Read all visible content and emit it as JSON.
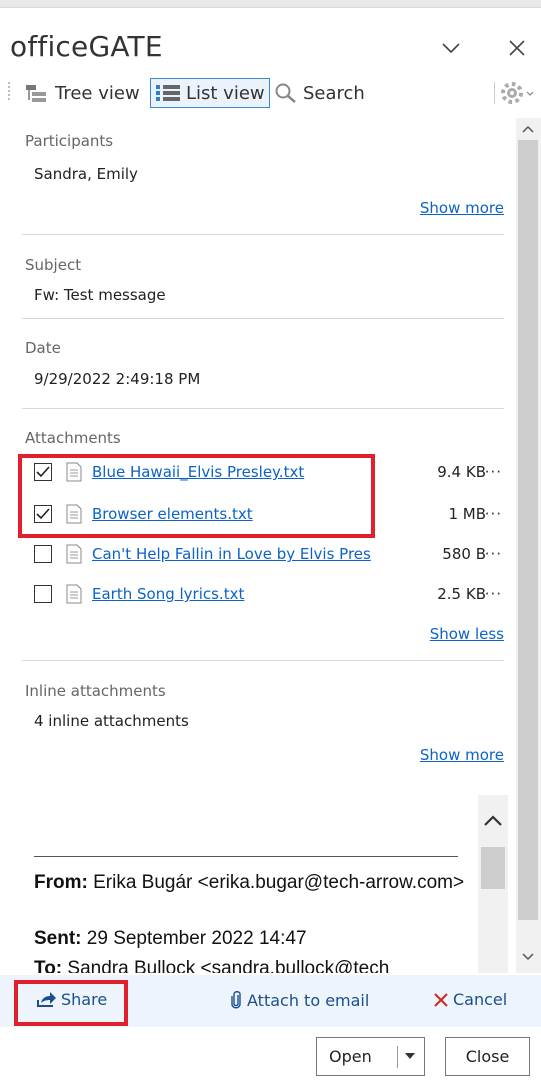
{
  "app": {
    "title": "officeGATE"
  },
  "toolbar": {
    "tree_view": "Tree view",
    "list_view": "List view",
    "search": "Search"
  },
  "participants": {
    "label": "Participants",
    "value": "Sandra, Emily",
    "show_more": "Show more"
  },
  "subject": {
    "label": "Subject",
    "value": "Fw: Test message"
  },
  "date": {
    "label": "Date",
    "value": "9/29/2022 2:49:18 PM"
  },
  "attachments": {
    "label": "Attachments",
    "show_less": "Show less",
    "items": [
      {
        "name": "Blue Hawaii_Elvis Presley.txt",
        "size": "9.4 KB",
        "checked": true
      },
      {
        "name": "Browser elements.txt",
        "size": "1 MB",
        "checked": true
      },
      {
        "name": "Can't Help Fallin in Love by Elvis Pres",
        "size": "580 B",
        "checked": false
      },
      {
        "name": "Earth Song lyrics.txt",
        "size": "2.5 KB",
        "checked": false
      }
    ],
    "more": "···"
  },
  "inline": {
    "label": "Inline attachments",
    "value": "4 inline attachments",
    "show_more": "Show more"
  },
  "preview": {
    "from_label": "From:",
    "from_value": "Erika Bugár <erika.bugar@tech-arrow.com>",
    "sent_label": "Sent:",
    "sent_value": "29 September 2022 14:47",
    "to_label": "To:",
    "to_value": "Sandra Bullock <sandra.bullock@tech"
  },
  "actions": {
    "share": "Share",
    "attach": "Attach to email",
    "cancel": "Cancel"
  },
  "footer": {
    "open": "Open",
    "close": "Close"
  },
  "colors": {
    "accent": "#0b62c8",
    "highlight": "#e0202c",
    "cancel": "#c9302c"
  }
}
